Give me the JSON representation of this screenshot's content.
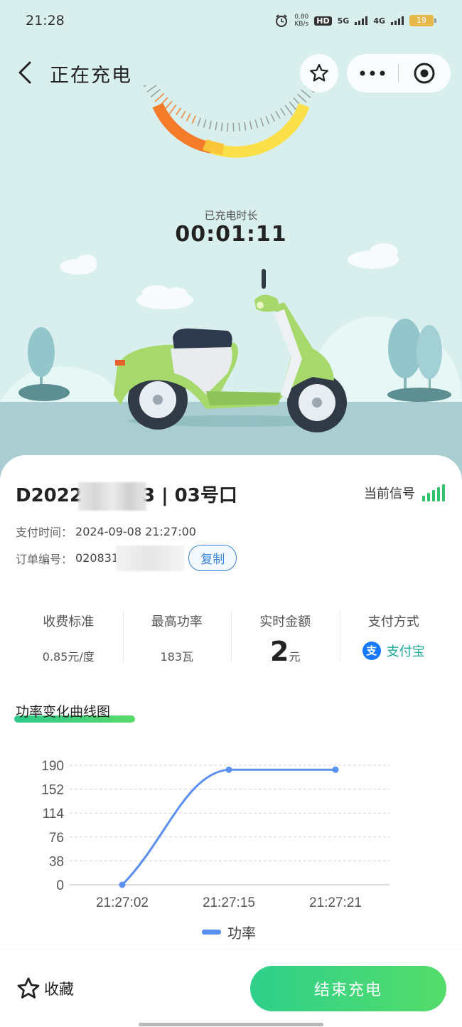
{
  "status_bar": {
    "time": "21:28",
    "speed_value": "0.80",
    "speed_unit": "KB/s",
    "hd": "HD",
    "net1": "5G",
    "net2": "4G",
    "battery": "19"
  },
  "nav": {
    "title": "正在充电"
  },
  "charging": {
    "duration_label": "已充电时长",
    "duration": "00:01:11"
  },
  "station": {
    "id_prefix": "D2022",
    "id_suffix": "3 | 03号口",
    "signal_label": "当前信号"
  },
  "order": {
    "pay_time_label": "支付时间：",
    "pay_time": "2024-09-08 21:27:00",
    "order_no_label": "订单编号：",
    "order_no_prefix": "020831",
    "order_no_suffix": "6",
    "copy_label": "复制"
  },
  "stats": [
    {
      "label": "收费标准",
      "value": "0.85元/度"
    },
    {
      "label": "最高功率",
      "value": "183瓦"
    },
    {
      "label": "实时金额",
      "value": "2",
      "unit": "元"
    },
    {
      "label": "支付方式",
      "value": "支付宝",
      "icon": "alipay-icon"
    }
  ],
  "chart_title": "功率变化曲线图",
  "chart_data": {
    "type": "line",
    "categories": [
      "21:27:02",
      "21:27:15",
      "21:27:21"
    ],
    "series": [
      {
        "name": "功率",
        "values": [
          0,
          183,
          183
        ],
        "color": "#5b8ff0"
      }
    ],
    "yticks": [
      0,
      38,
      76,
      114,
      152,
      190
    ],
    "ylim": [
      0,
      190
    ],
    "grid": true,
    "legend": "bottom"
  },
  "bottom": {
    "collect_label": "收藏",
    "end_label": "结束充电"
  },
  "colors": {
    "accent": "#2fd08b",
    "chart_line": "#5b8ff0",
    "signal": "#31c36b",
    "link": "#3a86d6"
  }
}
